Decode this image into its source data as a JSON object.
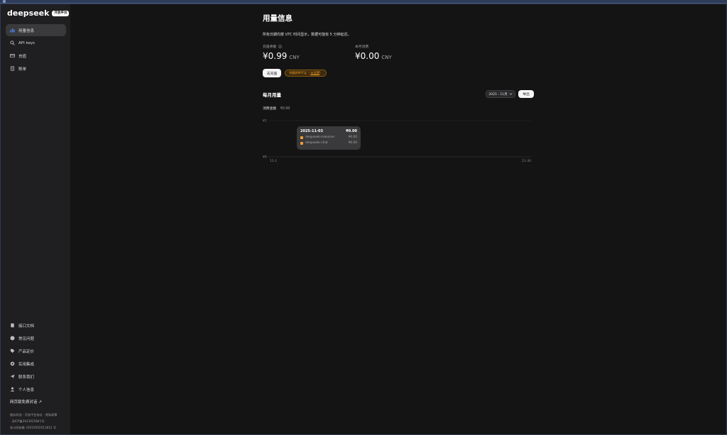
{
  "browser": {
    "tabs": [
      "",
      "",
      "",
      "",
      "",
      "",
      ""
    ],
    "right_tab": ""
  },
  "brand": {
    "logo": "deepseek",
    "badge": "开放平台"
  },
  "sidebar": {
    "top_items": [
      {
        "label": "用量信息",
        "icon": "bar-chart-icon",
        "active": true
      },
      {
        "label": "API keys",
        "icon": "search-icon",
        "active": false
      },
      {
        "label": "充值",
        "icon": "card-icon",
        "active": false
      },
      {
        "label": "账单",
        "icon": "receipt-icon",
        "active": false
      }
    ],
    "bottom_items": [
      {
        "label": "接口文档",
        "icon": "document-icon"
      },
      {
        "label": "常见问题",
        "icon": "question-icon"
      },
      {
        "label": "产品定价",
        "icon": "tag-icon"
      },
      {
        "label": "实用集成",
        "icon": "puzzle-icon"
      },
      {
        "label": "联系我们",
        "icon": "send-icon"
      },
      {
        "label": "个人信息",
        "icon": "user-icon"
      }
    ],
    "free_link": "网页版免费对话 ↗",
    "footer_lines": [
      "服务状态 · 开放平台协议 · 隐私政策",
      "· 浙ICP备2023025841号 ·",
      "浙公网安备 33010502011812 号"
    ]
  },
  "main": {
    "title": "用量信息",
    "notice": "所有日期均按 UTC 时间显示，数据可能有 5 分钟延迟。",
    "balance": {
      "label": "充值余额",
      "amount": "¥0.99",
      "unit": "CNY"
    },
    "monthly": {
      "label": "本月消费",
      "amount": "¥0.00",
      "unit": "CNY"
    },
    "recharge_button": "去充值",
    "warning": "余额即将不足",
    "warning_link": "去设置",
    "section_title": "每月用量",
    "month_select": "2025 - 11月",
    "export_button": "导出",
    "total_label": "消费金额",
    "total_value": "¥0.00"
  },
  "chart_data": {
    "type": "bar",
    "title": "",
    "x_start_label": "11-1",
    "x_end_label": "11-30",
    "y_tick_labels": [
      "¥1",
      "¥0"
    ],
    "ylim": [
      0,
      1
    ],
    "grid": true,
    "series": [
      {
        "name": "deepseek-reasoner",
        "color": "#f0a030",
        "values": []
      },
      {
        "name": "deepseek-chat",
        "color": "#f0a030",
        "values": []
      }
    ],
    "tooltip": {
      "date": "2025-11-03",
      "total": "¥0.00",
      "rows": [
        {
          "name": "deepseek-reasoner",
          "value": "¥0.00"
        },
        {
          "name": "deepseek-chat",
          "value": "¥0.00"
        }
      ]
    }
  }
}
